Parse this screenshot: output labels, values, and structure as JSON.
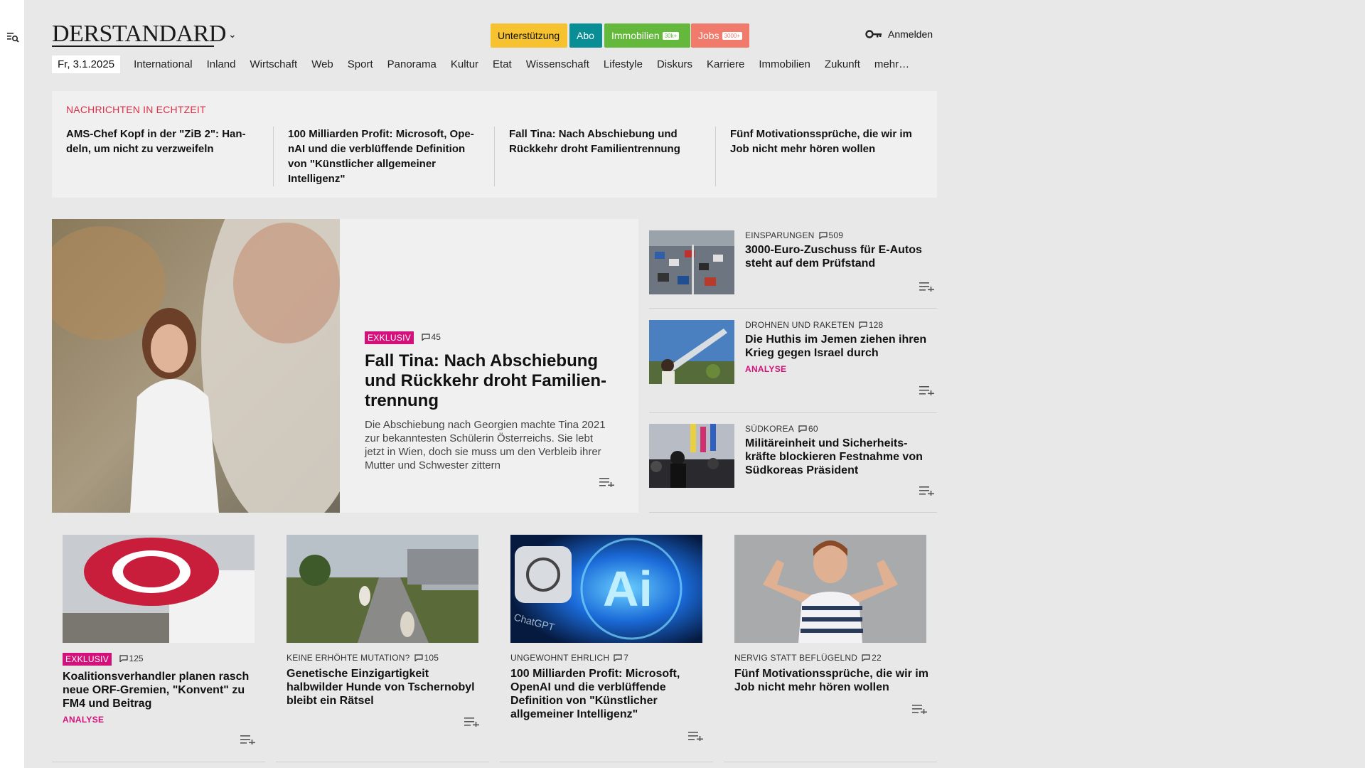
{
  "header": {
    "logo": "DERSTANDARD",
    "support_label": "Unterstützung",
    "abo_label": "Abo",
    "immo_label": "Immobilien",
    "immo_tag": "30k+",
    "jobs_label": "Jobs",
    "jobs_tag": "3000+",
    "login_label": "Anmelden"
  },
  "nav": {
    "date": "Fr, 3.1.2025",
    "items": [
      "International",
      "Inland",
      "Wirtschaft",
      "Web",
      "Sport",
      "Panorama",
      "Kultur",
      "Etat",
      "Wissenschaft",
      "Lifestyle",
      "Diskurs",
      "Karriere",
      "Immobilien",
      "Zukunft",
      "mehr…"
    ]
  },
  "live": {
    "title": "NACHRICHTEN IN ECHTZEIT",
    "items": [
      "AMS-Chef Kopf in der \"ZiB 2\": Han­deln, um nicht zu verzweifeln",
      "100 Milliarden Profit: Microsoft, Ope­nAI und die verblüffende Definition von \"Künstlicher allgemeiner Intelligenz\"",
      "Fall Tina: Nach Abschiebung und Rückkehr droht Familientrennung",
      "Fünf Motivationssprüche, die wir im Job nicht mehr hören wollen"
    ]
  },
  "lead": {
    "badge": "EXKLUSIV",
    "comments": "45",
    "title": "Fall Tina: Nach Abschiebung und Rückkehr droht Familien­trennung",
    "teaser": "Die Abschiebung nach Georgien machte Tina 2021 zur bekanntesten Schülerin Österreichs. Sie lebt jetzt in Wien, doch sie muss um den Verbleib ihrer Mutter und Schwester zittern"
  },
  "side": [
    {
      "kicker": "EINSPARUNGEN",
      "comments": "509",
      "title": "3000-Euro-Zuschuss für E-Autos steht auf dem Prüfstand",
      "analyse": ""
    },
    {
      "kicker": "DROHNEN UND RAKETEN",
      "comments": "128",
      "title": "Die Huthis im Jemen ziehen ihren Krieg gegen Israel durch",
      "analyse": "ANALYSE"
    },
    {
      "kicker": "SÜDKOREA",
      "comments": "60",
      "title": "Militäreinheit und Sicherheits­kräfte blockieren Festnahme von Südkoreas Präsident",
      "analyse": ""
    }
  ],
  "cards": [
    {
      "badge": "EXKLUSIV",
      "kicker": "",
      "comments": "125",
      "title": "Koalitionsverhandler planen rasch neue ORF-Gremien, \"Konvent\" zu FM4 und Beitrag",
      "analyse": "ANALYSE"
    },
    {
      "badge": "",
      "kicker": "KEINE ERHÖHTE MUTATION?",
      "comments": "105",
      "title": "Genetische Einzigartigkeit halbwilder Hunde von Tschernobyl bleibt ein Rätsel",
      "analyse": ""
    },
    {
      "badge": "",
      "kicker": "UNGEWOHNT EHRLICH",
      "comments": "7",
      "title": "100 Milliarden Profit: Microsoft, OpenAI und die verblüffende Definition von \"Künstlicher allgemeiner Intelligenz\"",
      "analyse": ""
    },
    {
      "badge": "",
      "kicker": "NERVIG STATT BEFLÜGELND",
      "comments": "22",
      "title": "Fünf Motivationssprüche, die wir im Job nicht mehr hören wollen",
      "analyse": ""
    }
  ],
  "card_image_text": {
    "chatgpt": "ChatGPT",
    "ai": "Ai"
  },
  "colors": {
    "accent_red": "#d93047",
    "exklusiv_magenta": "#d4117b",
    "abo_teal": "#098e96",
    "immo_green": "#64b83c",
    "jobs_salmon": "#f07a6c",
    "support_yellow": "#f6c22f"
  }
}
